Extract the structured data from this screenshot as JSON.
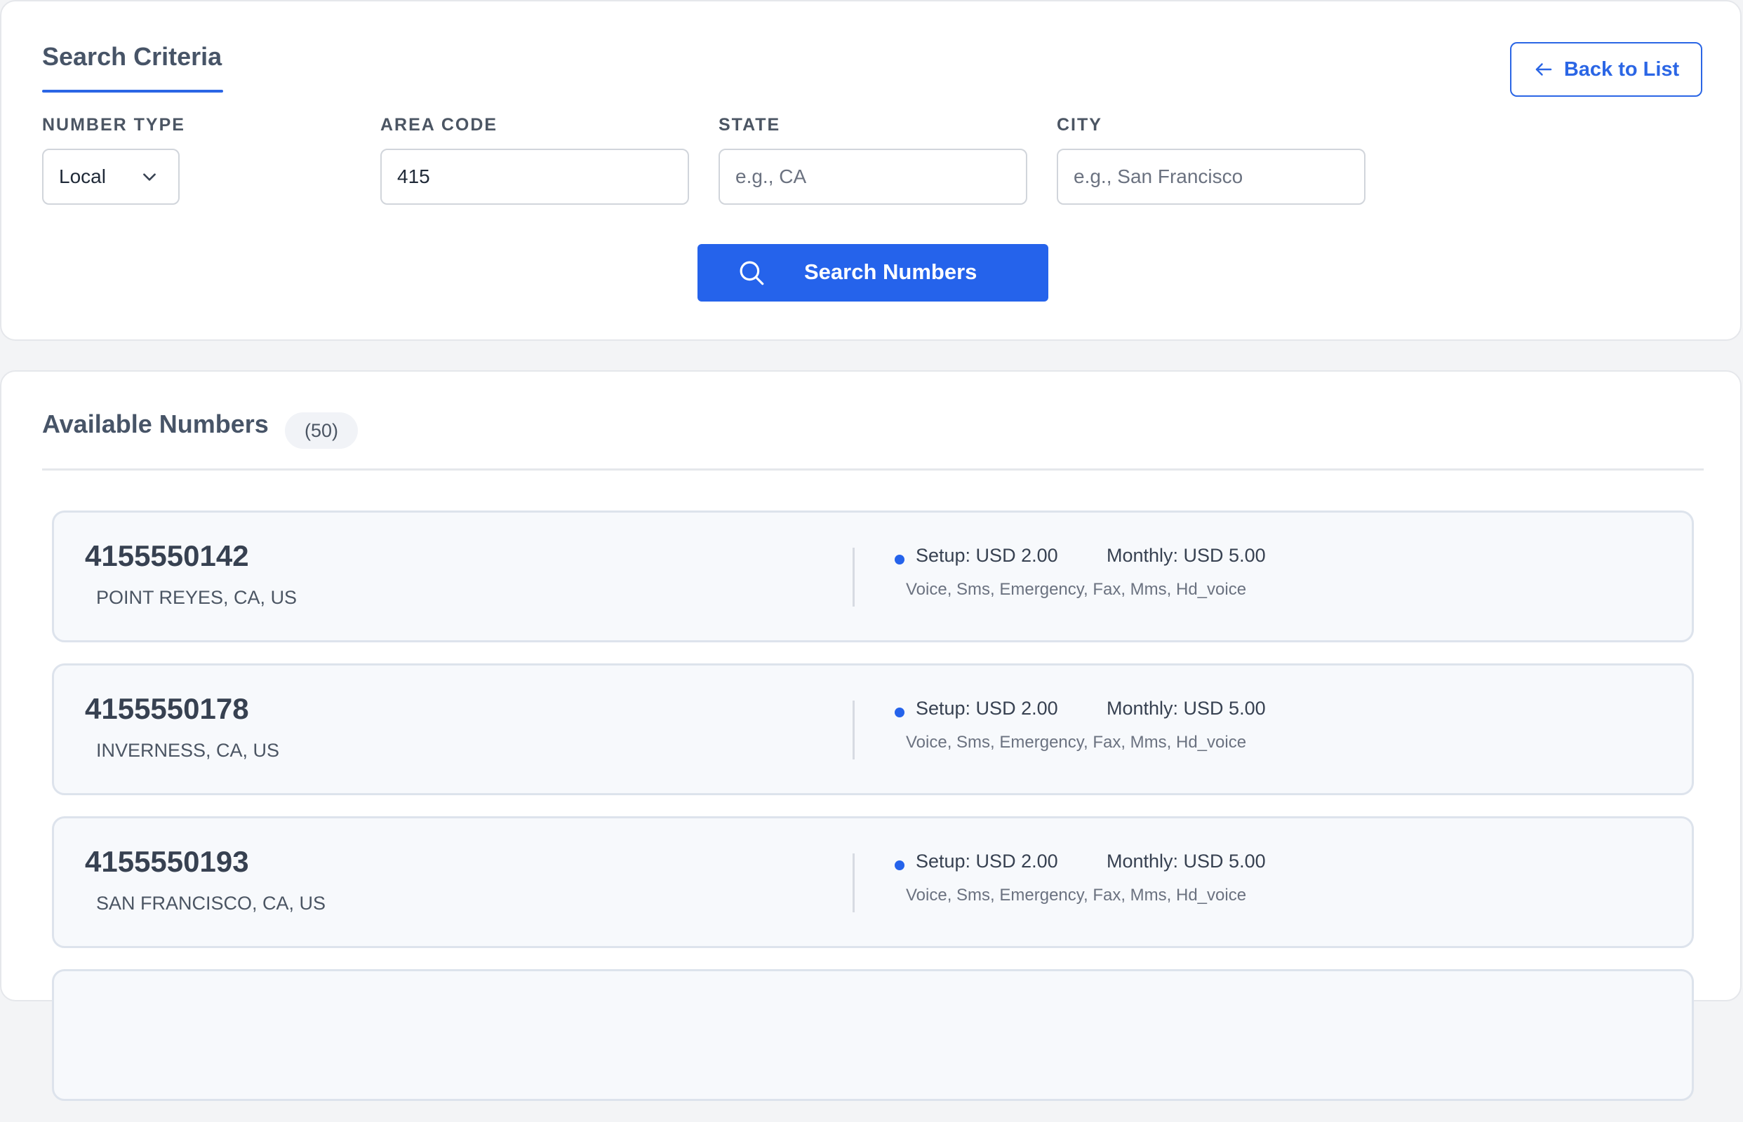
{
  "search": {
    "title": "Search Criteria",
    "back_label": "Back to List",
    "number_type": {
      "label": "NUMBER TYPE",
      "value": "Local"
    },
    "area_code": {
      "label": "AREA CODE",
      "value": "415",
      "placeholder": ""
    },
    "state": {
      "label": "STATE",
      "value": "",
      "placeholder": "e.g., CA"
    },
    "city": {
      "label": "CITY",
      "value": "",
      "placeholder": "e.g., San Francisco"
    },
    "search_label": "Search Numbers"
  },
  "results": {
    "title": "Available Numbers",
    "count": "(50)",
    "items": [
      {
        "number": "4155550142",
        "location": "POINT REYES, CA, US",
        "setup": "Setup: USD 2.00",
        "monthly": "Monthly: USD 5.00",
        "features": "Voice, Sms, Emergency, Fax, Mms, Hd_voice"
      },
      {
        "number": "4155550178",
        "location": "INVERNESS, CA, US",
        "setup": "Setup: USD 2.00",
        "monthly": "Monthly: USD 5.00",
        "features": "Voice, Sms, Emergency, Fax, Mms, Hd_voice"
      },
      {
        "number": "4155550193",
        "location": "SAN FRANCISCO, CA, US",
        "setup": "Setup: USD 2.00",
        "monthly": "Monthly: USD 5.00",
        "features": "Voice, Sms, Emergency, Fax, Mms, Hd_voice"
      },
      {
        "number": "",
        "location": "",
        "setup": "",
        "monthly": "",
        "features": ""
      }
    ]
  },
  "colors": {
    "accent": "#2563eb",
    "page_bg": "#f3f4f6",
    "card_bg": "#ffffff",
    "item_bg": "#f7f9fc",
    "heading": "#475467"
  },
  "icons": [
    "arrow-left-icon",
    "chevron-down-icon",
    "search-icon",
    "status-dot-icon"
  ]
}
